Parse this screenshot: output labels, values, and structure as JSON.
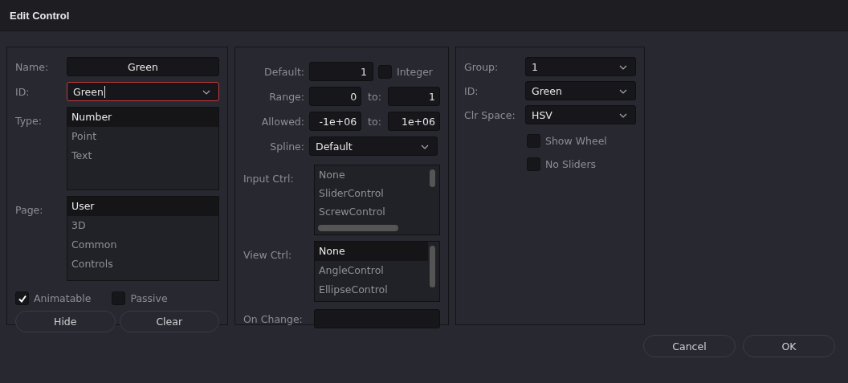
{
  "window": {
    "title": "Edit Control"
  },
  "left": {
    "name": {
      "label": "Name:",
      "value": "Green"
    },
    "id": {
      "label": "ID:",
      "value": "Green"
    },
    "type": {
      "label": "Type:",
      "items": [
        {
          "label": "Number",
          "selected": true
        },
        {
          "label": "Point",
          "selected": false
        },
        {
          "label": "Text",
          "selected": false
        }
      ]
    },
    "page": {
      "label": "Page:",
      "items": [
        {
          "label": "User",
          "selected": true
        },
        {
          "label": "3D",
          "selected": false
        },
        {
          "label": "Common",
          "selected": false
        },
        {
          "label": "Controls",
          "selected": false
        }
      ]
    },
    "checks": [
      {
        "label": "Animatable",
        "checked": true
      },
      {
        "label": "Passive",
        "checked": false
      }
    ],
    "buttons": [
      "Hide",
      "Clear"
    ]
  },
  "middle": {
    "default": {
      "label": "Default:",
      "value": "1",
      "check": {
        "label": "Integer",
        "checked": false
      }
    },
    "range": {
      "label": "Range:",
      "from": "0",
      "to_label": "to:",
      "to": "1"
    },
    "allowed": {
      "label": "Allowed:",
      "from": "-1e+06",
      "to_label": "to:",
      "to": "1e+06"
    },
    "spline": {
      "label": "Spline:",
      "value": "Default"
    },
    "input_ctrl": {
      "label": "Input Ctrl:",
      "items": [
        {
          "label": "None",
          "selected": false
        },
        {
          "label": "SliderControl",
          "selected": false
        },
        {
          "label": "ScrewControl",
          "selected": false
        }
      ]
    },
    "view_ctrl": {
      "label": "View Ctrl:",
      "items": [
        {
          "label": "None",
          "selected": true
        },
        {
          "label": "AngleControl",
          "selected": false
        },
        {
          "label": "EllipseControl",
          "selected": false
        }
      ]
    },
    "on_change": {
      "label": "On Change:"
    }
  },
  "right": {
    "group": {
      "label": "Group:",
      "value": "1"
    },
    "id": {
      "label": "ID:",
      "value": "Green"
    },
    "clr_space": {
      "label": "Clr Space:",
      "value": "HSV"
    },
    "checks": [
      {
        "label": "Show Wheel",
        "checked": false
      },
      {
        "label": "No Sliders",
        "checked": false
      }
    ]
  },
  "buttons": [
    "Cancel",
    "OK"
  ]
}
